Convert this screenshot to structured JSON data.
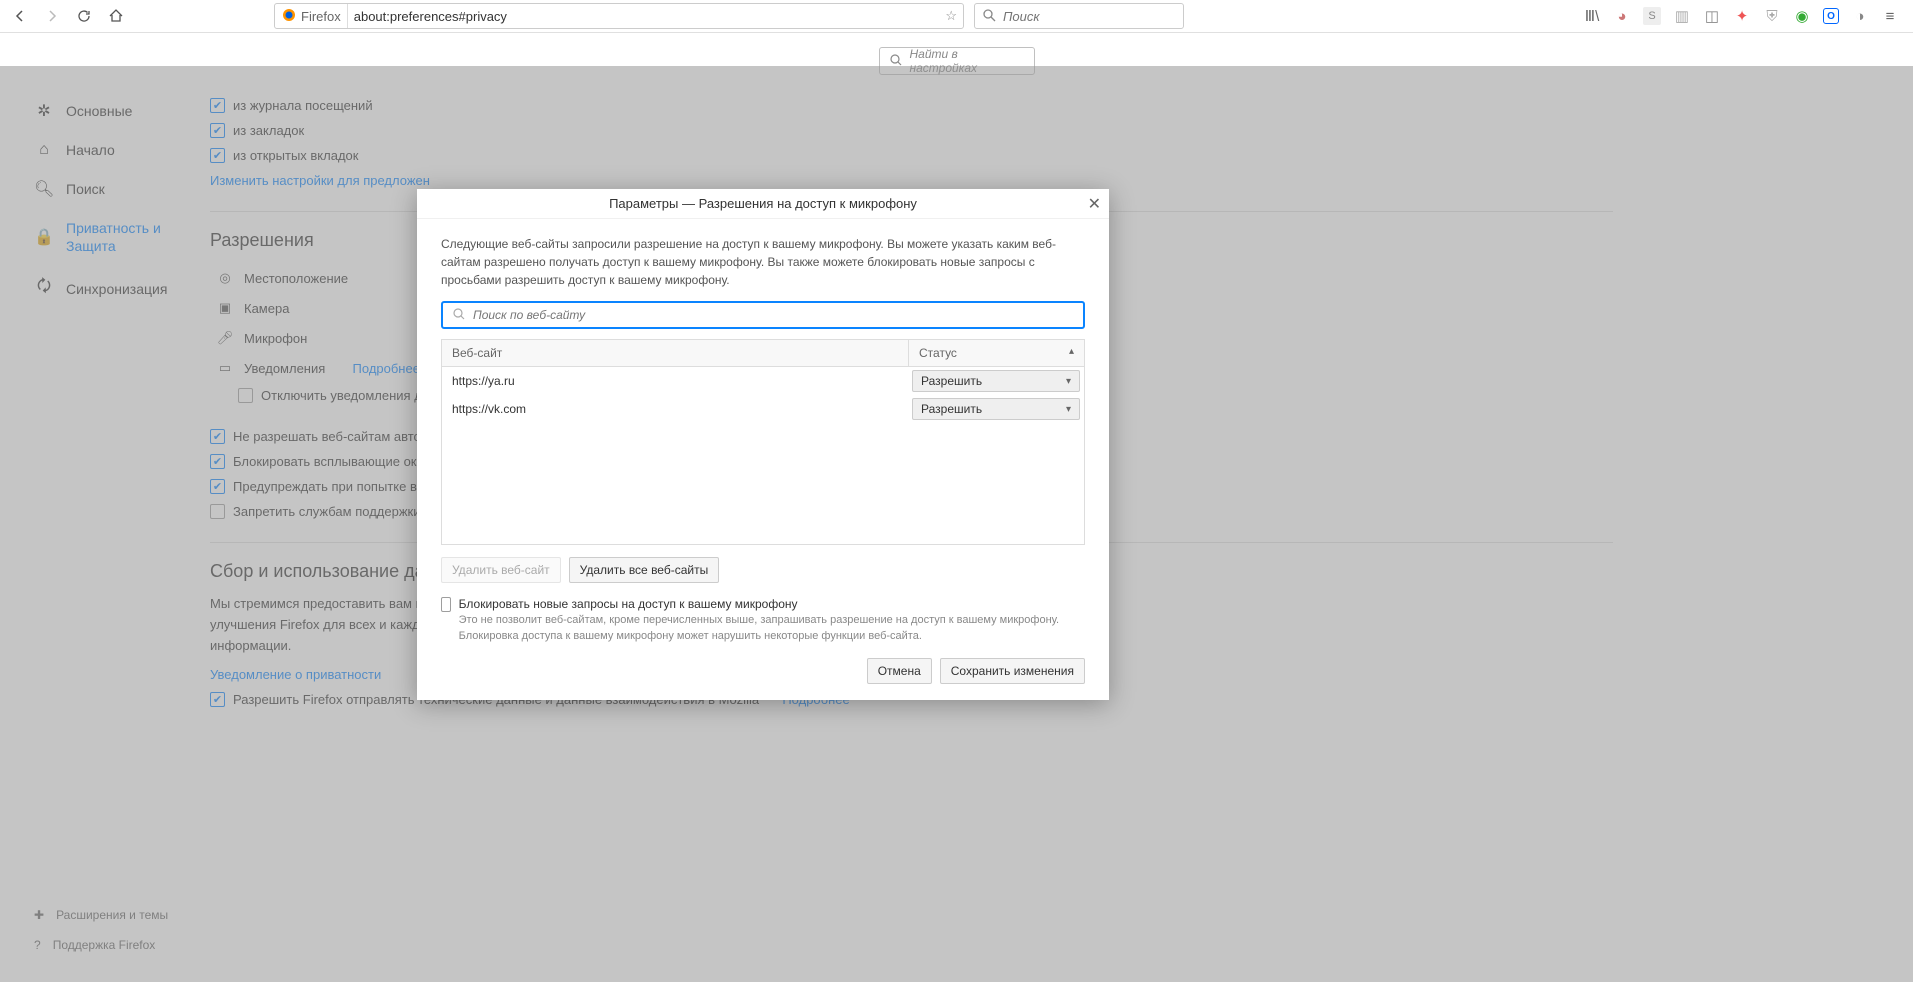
{
  "toolbar": {
    "identity_label": "Firefox",
    "url": "about:preferences#privacy",
    "search_placeholder": "Поиск"
  },
  "prefs_search_placeholder": "Найти в настройках",
  "categories": {
    "general": "Основные",
    "home": "Начало",
    "search": "Поиск",
    "privacy_line1": "Приватность и",
    "privacy_line2": "Защита",
    "sync": "Синхронизация"
  },
  "footer": {
    "addons": "Расширения и темы",
    "support": "Поддержка Firefox"
  },
  "address_bar": {
    "history": "из журнала посещений",
    "bookmarks": "из закладок",
    "open_tabs": "из открытых вкладок",
    "change_link": "Изменить настройки для предложен"
  },
  "permissions": {
    "title": "Разрешения",
    "location": "Местоположение",
    "camera": "Камера",
    "microphone": "Микрофон",
    "notifications": "Уведомления",
    "notifications_more": "Подробнее",
    "disable_notifications": "Отключить уведомления до",
    "block_autoplay": "Не разрешать веб-сайтам автом",
    "block_popups": "Блокировать всплывающие окна",
    "warn_install": "Предупреждать при попытке веб",
    "disable_accessibility": "Запретить службам поддержки д"
  },
  "data_collection": {
    "title": "Сбор и использование дан",
    "desc_line1": "Мы стремимся предоставить вам выбор и собирать только то, что нам нужно, для выпуска и",
    "desc_line2": "улучшения Firefox для всех и каждого. Мы всегда спрашиваем разрешения перед получением личной",
    "desc_line3": "информации.",
    "privacy_link": "Уведомление о приватности",
    "telemetry": "Разрешить Firefox отправлять технические данные и данные взаимодействия в Mozilla",
    "telemetry_more": "Подробнее"
  },
  "dialog": {
    "title": "Параметры — Разрешения на доступ к микрофону",
    "desc": "Следующие веб-сайты запросили разрешение на доступ к вашему микрофону. Вы можете указать каким веб-сайтам разрешено получать доступ к вашему микрофону. Вы также можете блокировать новые запросы с просьбами разрешить доступ к вашему микрофону.",
    "search_placeholder": "Поиск по веб-сайту",
    "col_site": "Веб-сайт",
    "col_status": "Статус",
    "rows": [
      {
        "site": "https://ya.ru",
        "status": "Разрешить"
      },
      {
        "site": "https://vk.com",
        "status": "Разрешить"
      }
    ],
    "remove_site": "Удалить веб-сайт",
    "remove_all": "Удалить все веб-сайты",
    "block_new_label": "Блокировать новые запросы на доступ к вашему микрофону",
    "block_new_desc": "Это не позволит веб-сайтам, кроме перечисленных выше, запрашивать разрешение на доступ к вашему микрофону. Блокировка доступа к вашему микрофону может нарушить некоторые функции веб-сайта.",
    "cancel": "Отмена",
    "save": "Сохранить изменения"
  }
}
